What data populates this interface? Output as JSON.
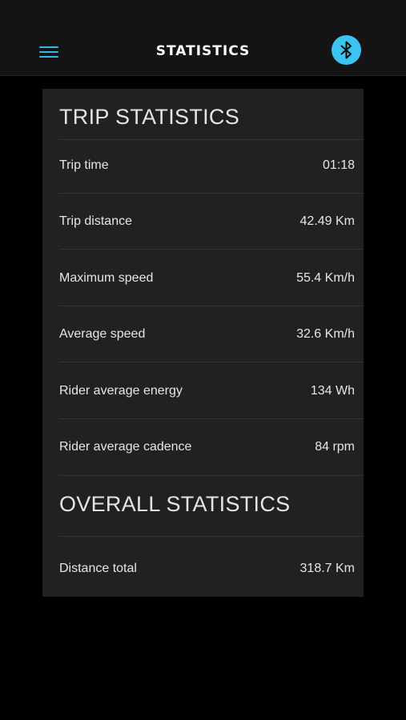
{
  "header": {
    "title": "STATISTICS",
    "menu_icon": "hamburger-menu-icon",
    "bluetooth_icon": "bluetooth-icon",
    "accent_color": "#35b6e6",
    "bluetooth_color": "#3cc4f0"
  },
  "trip": {
    "title": "TRIP STATISTICS",
    "rows": [
      {
        "label": "Trip time",
        "value": "01:18"
      },
      {
        "label": "Trip distance",
        "value": "42.49 Km"
      },
      {
        "label": "Maximum speed",
        "value": "55.4 Km/h"
      },
      {
        "label": "Average speed",
        "value": "32.6 Km/h"
      },
      {
        "label": "Rider average energy",
        "value": "134 Wh"
      },
      {
        "label": "Rider average cadence",
        "value": "84 rpm"
      }
    ]
  },
  "overall": {
    "title": "OVERALL STATISTICS",
    "rows": [
      {
        "label": "Distance total",
        "value": "318.7 Km"
      }
    ]
  }
}
